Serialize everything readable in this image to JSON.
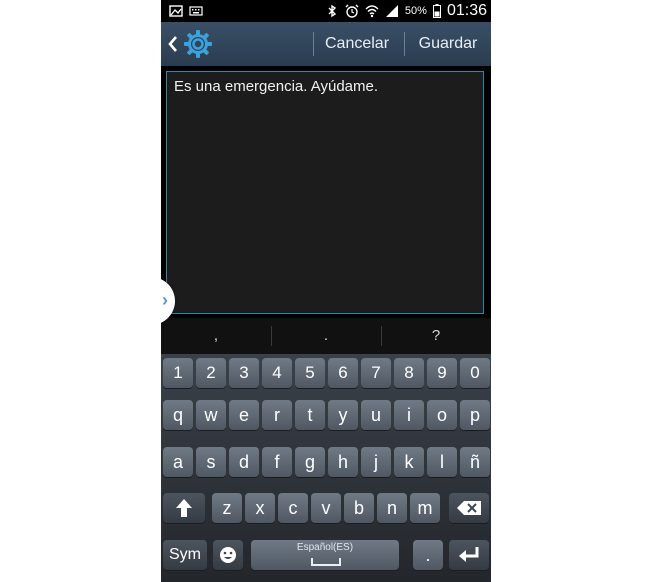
{
  "status_bar": {
    "battery_percent": "50%",
    "time": "01:36"
  },
  "action_bar": {
    "cancel_label": "Cancelar",
    "save_label": "Guardar"
  },
  "editor": {
    "text": "Es una emergencia. Ayúdame."
  },
  "suggestions": [
    ",",
    ".",
    "?"
  ],
  "keyboard": {
    "row_digits": [
      "1",
      "2",
      "3",
      "4",
      "5",
      "6",
      "7",
      "8",
      "9",
      "0"
    ],
    "row_1": [
      "q",
      "w",
      "e",
      "r",
      "t",
      "y",
      "u",
      "i",
      "o",
      "p"
    ],
    "row_2": [
      "a",
      "s",
      "d",
      "f",
      "g",
      "h",
      "j",
      "k",
      "l",
      "ñ"
    ],
    "row_3": [
      "z",
      "x",
      "c",
      "v",
      "b",
      "n",
      "m"
    ],
    "sym_label": "Sym",
    "space_label": "Español(ES)",
    "period_key": ".",
    "colors": {
      "accent": "#2f87a6",
      "actionbar": "#34485e"
    }
  }
}
